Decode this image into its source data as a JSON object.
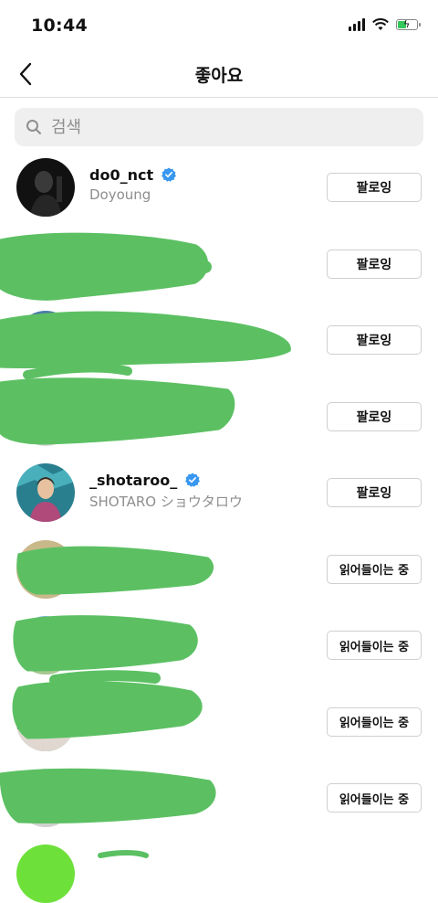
{
  "status_bar": {
    "time": "10:44"
  },
  "header": {
    "title": "좋아요"
  },
  "search": {
    "placeholder": "검색"
  },
  "users": [
    {
      "username": "do0_nct",
      "fullname": "Doyoung",
      "verified": true,
      "button": "팔로잉"
    },
    {
      "username": "",
      "fullname": "",
      "verified": false,
      "button": "팔로잉"
    },
    {
      "username": "",
      "fullname": "",
      "verified": false,
      "button": "팔로잉"
    },
    {
      "username": "",
      "fullname": "",
      "verified": false,
      "button": "팔로잉"
    },
    {
      "username": "_shotaroo_",
      "fullname": "SHOTARO ショウタロウ",
      "verified": true,
      "button": "팔로잉"
    },
    {
      "username": "",
      "fullname": "",
      "verified": false,
      "button": "읽어들이는 중"
    },
    {
      "username": "",
      "fullname": "",
      "verified": false,
      "button": "읽어들이는 중"
    },
    {
      "username": "",
      "fullname": "",
      "verified": false,
      "button": "읽어들이는 중"
    },
    {
      "username": "",
      "fullname": "",
      "verified": false,
      "button": "읽어들이는 중"
    }
  ],
  "colors": {
    "accent": "#3897f0",
    "redaction": "#5cc063",
    "muted": "#8e8e8e"
  }
}
